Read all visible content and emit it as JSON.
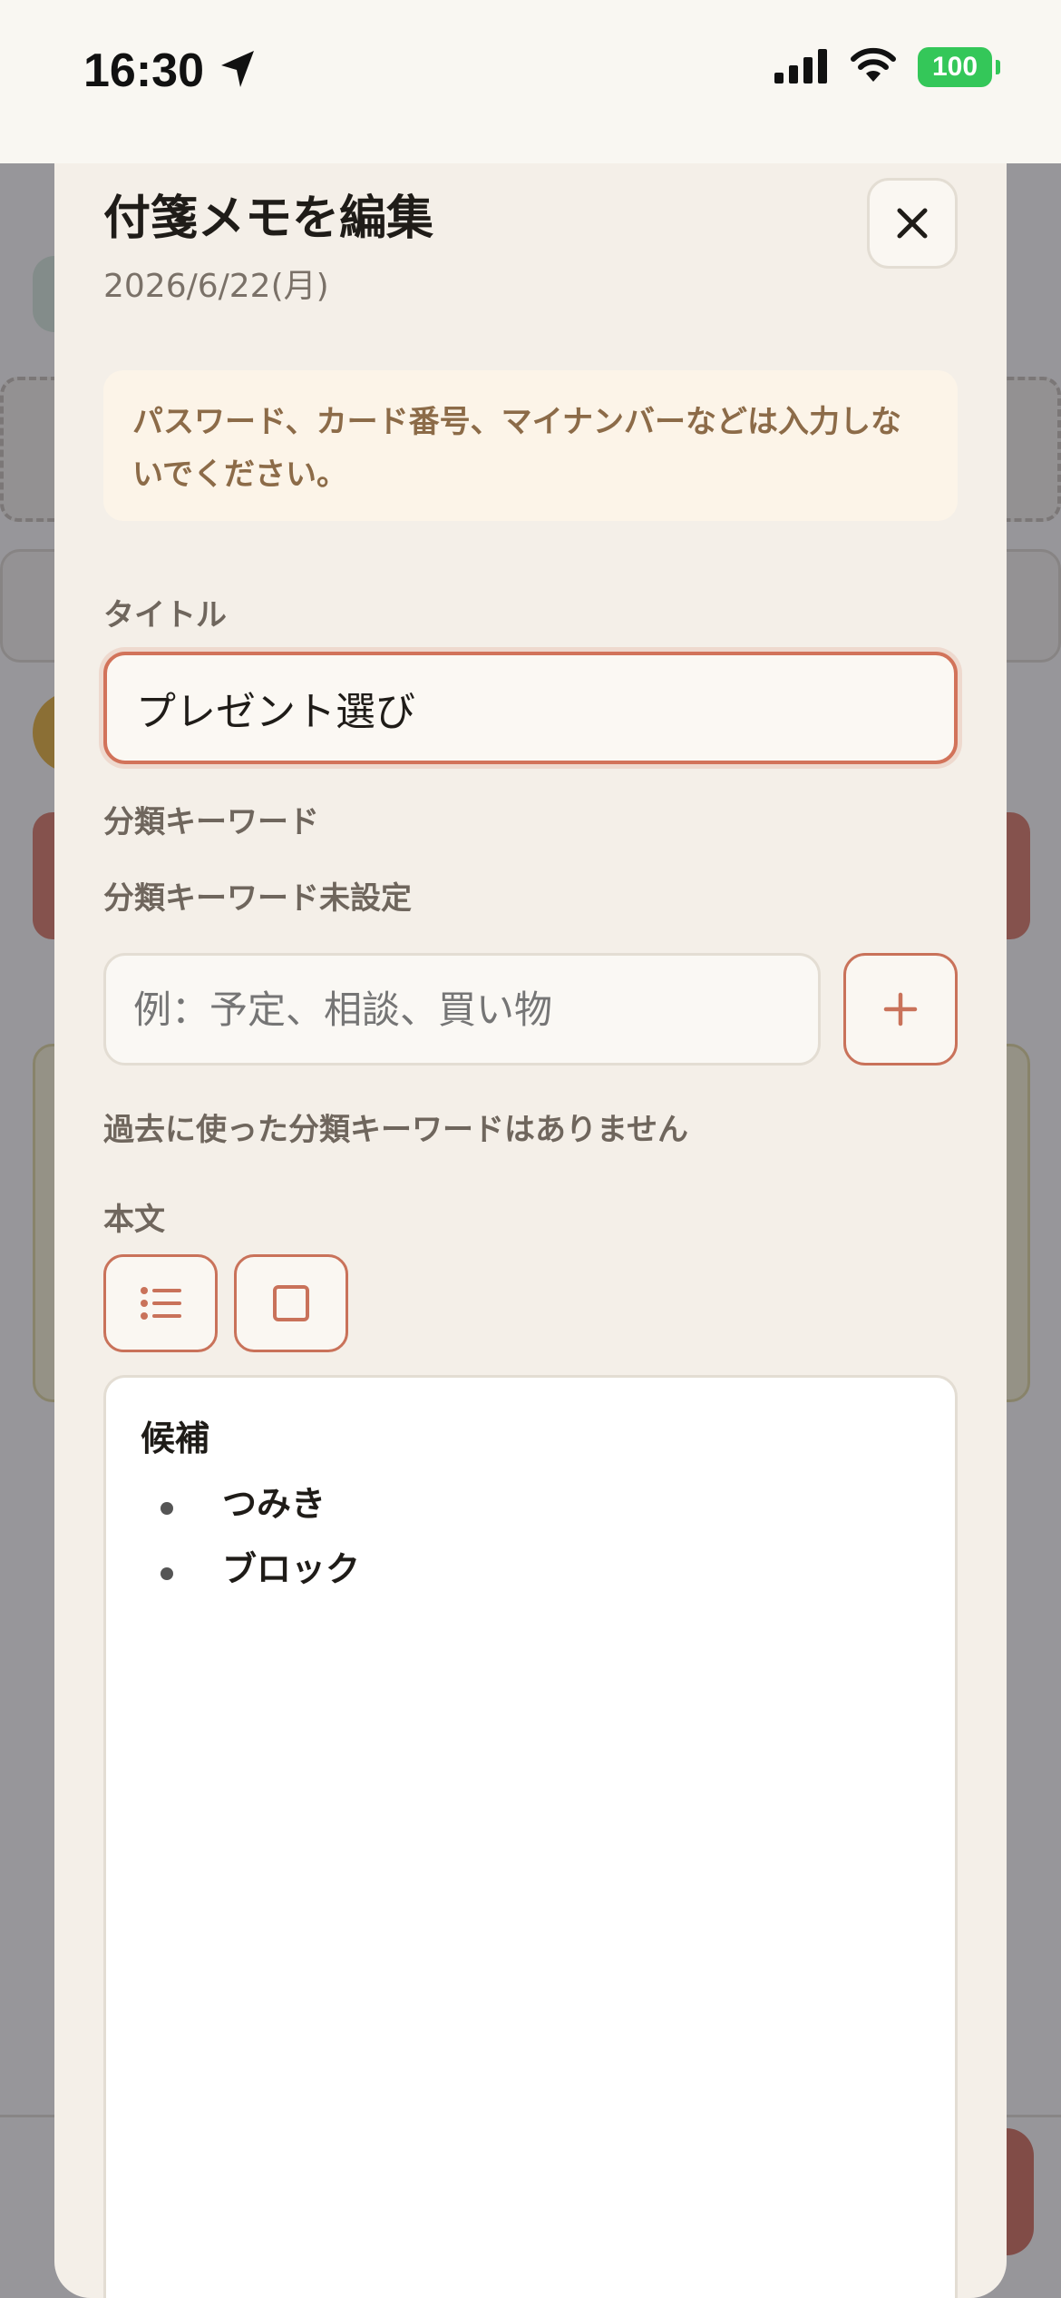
{
  "status_bar": {
    "time": "16:30",
    "battery": "100"
  },
  "modal": {
    "title": "付箋メモを編集",
    "date": "2026/6/22(月)",
    "warning": "パスワード、カード番号、マイナンバーなどは入力しないでください。",
    "title_label": "タイトル",
    "title_value": "プレゼント選び",
    "keyword_label": "分類キーワード",
    "keyword_unset": "分類キーワード未設定",
    "keyword_placeholder": "例：予定、相談、買い物",
    "no_past_keywords": "過去に使った分類キーワードはありません",
    "body_label": "本文",
    "body": {
      "heading": "候補",
      "items": [
        "つみき",
        "ブロック"
      ]
    }
  },
  "colors": {
    "accent": "#c9725a",
    "sheet_bg": "#f4efe8",
    "warning_bg": "#fcf4e8",
    "warning_text": "#8c6b48",
    "battery": "#34c759"
  }
}
